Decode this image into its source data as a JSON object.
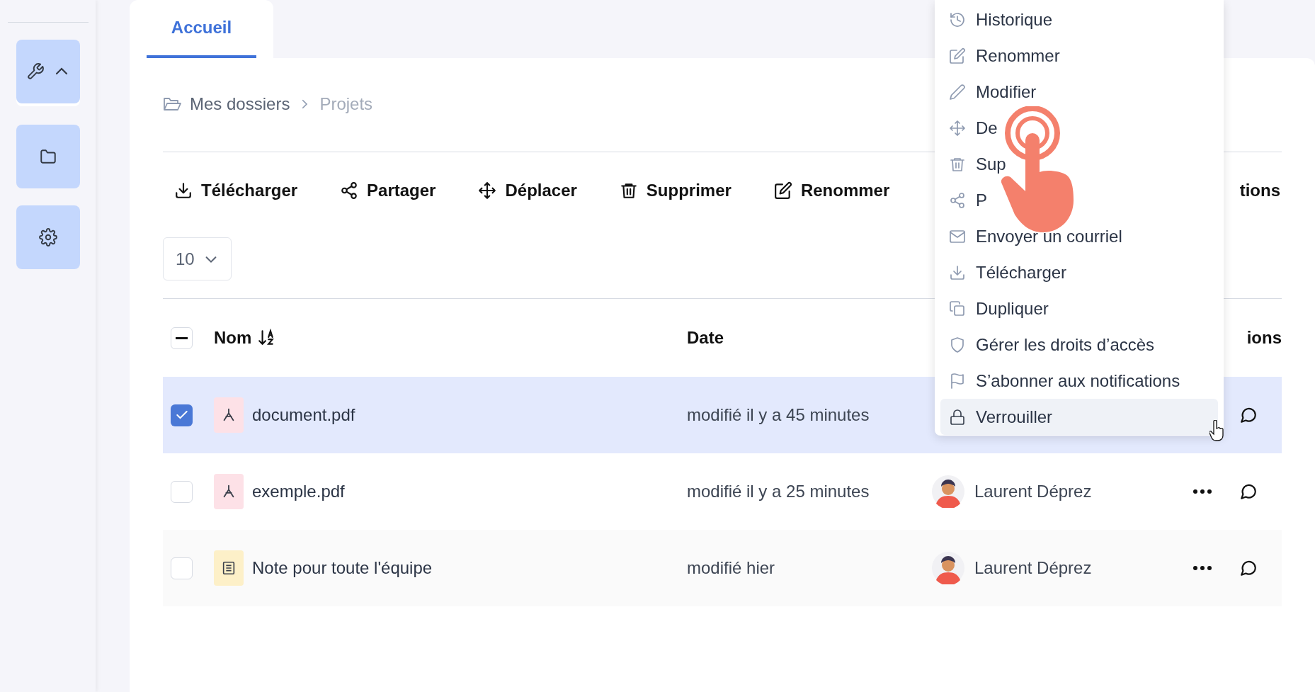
{
  "tabs": [
    {
      "label": "Accueil",
      "selected": true
    }
  ],
  "breadcrumb": [
    "Mes dossiers",
    "Projets"
  ],
  "toolbar": [
    "Télécharger",
    "Partager",
    "Déplacer",
    "Supprimer",
    "Renommer"
  ],
  "toolbar_cut_label": "tions",
  "page_size": "10",
  "table": {
    "select_all": {
      "indeterminate": true
    },
    "columns": [
      {
        "label": "Nom",
        "sorted": true
      },
      {
        "label": "Date",
        "sorted": false
      },
      {
        "label": "ions",
        "sorted": false
      }
    ],
    "rows": [
      {
        "kind": "pdf",
        "name": "document.pdf",
        "date": "modifié il y a 45 minutes",
        "selected": true
      },
      {
        "kind": "pdf",
        "name": "exemple.pdf",
        "date": "modifié il y a 25 minutes",
        "owner": "Laurent Déprez",
        "selected": false
      },
      {
        "kind": "note",
        "name": "Note pour toute l'équipe",
        "date": "modifié hier",
        "owner": "Laurent Déprez",
        "selected": false
      }
    ]
  },
  "context_menu": {
    "items": [
      {
        "label": "Historique",
        "selected": false
      },
      {
        "label": "Renommer",
        "selected": false
      },
      {
        "label": "Modifier",
        "selected": false
      },
      {
        "label": "De",
        "selected": false
      },
      {
        "label": "Sup",
        "selected": false
      },
      {
        "label": "P",
        "selected": false
      },
      {
        "label": "Envoyer un courriel",
        "selected": false
      },
      {
        "label": "Télécharger",
        "selected": false
      },
      {
        "label": "Dupliquer",
        "selected": false
      },
      {
        "label": "Gérer les droits d’accès",
        "selected": false
      },
      {
        "label": "S’abonner aux notifications",
        "selected": false
      },
      {
        "label": "Verrouiller",
        "selected": true
      }
    ]
  }
}
